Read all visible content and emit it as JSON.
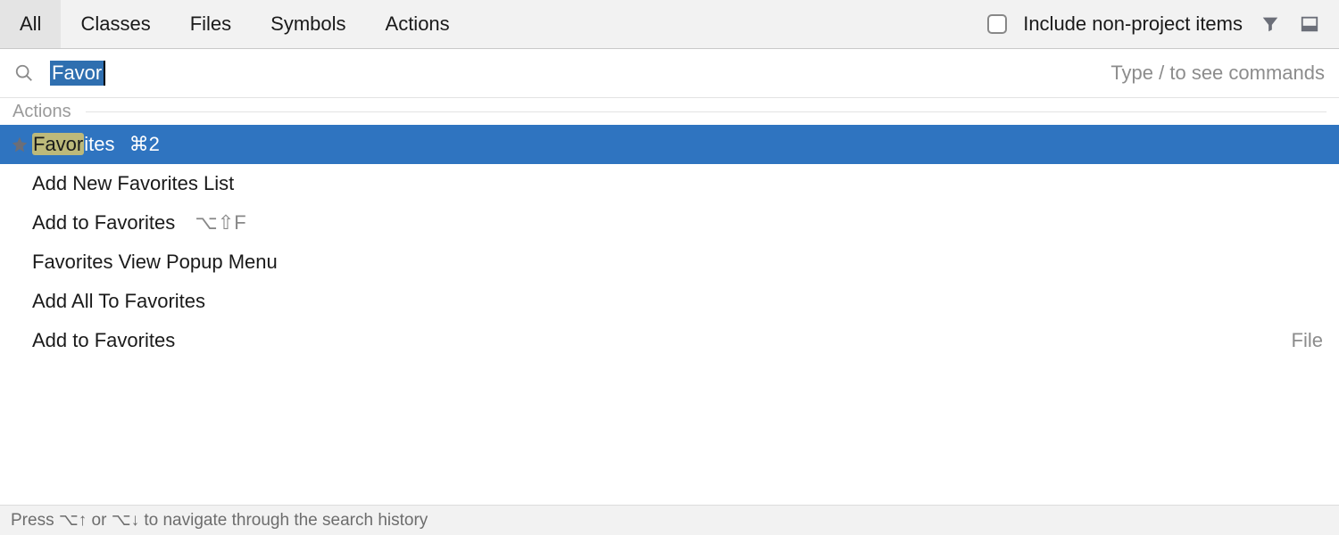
{
  "tabs": {
    "all": "All",
    "classes": "Classes",
    "files": "Files",
    "symbols": "Symbols",
    "actions": "Actions"
  },
  "topRight": {
    "include_label": "Include non-project items"
  },
  "search": {
    "query": "Favor",
    "hint": "Type / to see commands"
  },
  "section": {
    "actions": "Actions"
  },
  "results": [
    {
      "hl": "Favor",
      "rest": "ites",
      "shortcut": " ⌘2",
      "icon": "star",
      "right": "",
      "selected": true
    },
    {
      "hl": "",
      "rest": "Add New Favorites List",
      "shortcut": "",
      "icon": "",
      "right": "",
      "selected": false
    },
    {
      "hl": "",
      "rest": "Add to Favorites",
      "shortcut": "  ⌥⇧F",
      "icon": "",
      "right": "",
      "selected": false
    },
    {
      "hl": "",
      "rest": "Favorites View Popup Menu",
      "shortcut": "",
      "icon": "",
      "right": "",
      "selected": false
    },
    {
      "hl": "",
      "rest": "Add All To Favorites",
      "shortcut": "",
      "icon": "",
      "right": "",
      "selected": false
    },
    {
      "hl": "",
      "rest": "Add to Favorites",
      "shortcut": "",
      "icon": "",
      "right": "File",
      "selected": false
    }
  ],
  "footer": {
    "text": "Press ⌥↑ or ⌥↓ to navigate through the search history"
  }
}
